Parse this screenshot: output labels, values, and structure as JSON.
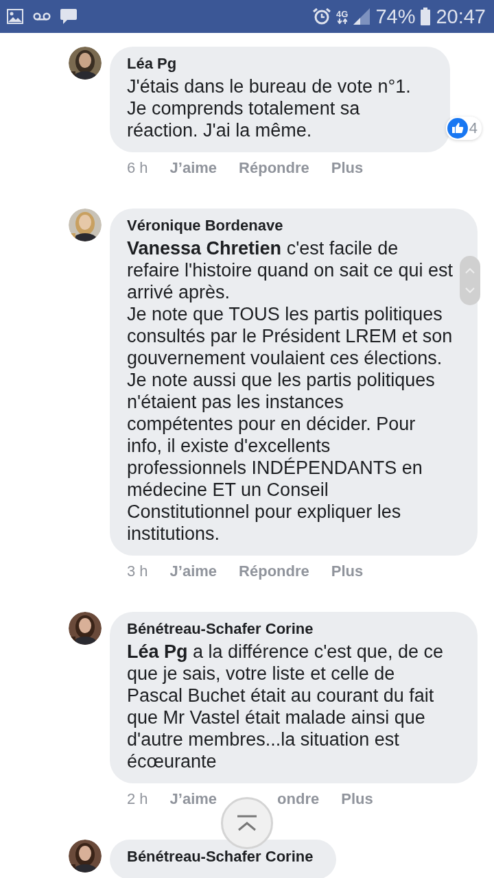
{
  "status_bar": {
    "network": "4G",
    "battery": "74%",
    "time": "20:47"
  },
  "comments": [
    {
      "author": "Léa Pg",
      "text": "J'étais dans le bureau de vote n°1.\nJe comprends totalement sa réaction. J'ai la même.",
      "reactions": {
        "count": "4"
      },
      "actions": [
        {
          "label": "6 h",
          "kind": "time"
        },
        {
          "label": "J’aime",
          "kind": "link"
        },
        {
          "label": "Répondre",
          "kind": "link"
        },
        {
          "label": "Plus",
          "kind": "link"
        }
      ]
    },
    {
      "author": "Véronique Bordenave",
      "text": "**Vanessa Chretien** c'est facile de refaire l'histoire quand on sait ce qui est arrivé après.\nJe note que TOUS les partis politiques consultés par le Président LREM et son gouvernement voulaient ces élections.\nJe note aussi que les partis politiques n'étaient pas les instances compétentes pour en décider. Pour info, il existe d'excellents professionnels INDÉPENDANTS en médecine ET un Conseil Constitutionnel pour expliquer les institutions.",
      "actions": [
        {
          "label": "3 h",
          "kind": "time"
        },
        {
          "label": "J’aime",
          "kind": "link"
        },
        {
          "label": "Répondre",
          "kind": "link"
        },
        {
          "label": "Plus",
          "kind": "link"
        }
      ]
    },
    {
      "author": "Bénétreau-Schafer Corine",
      "text": "**Léa Pg** a la différence c'est que, de ce que je sais, votre liste et celle de Pascal Buchet était au courant du fait que Mr Vastel était malade ainsi que d'autre membres...la situation est écœurante",
      "actions": [
        {
          "label": "2 h",
          "kind": "time"
        },
        {
          "label": "J’aime",
          "kind": "link"
        },
        {
          "label": "ondre",
          "kind": "covered"
        },
        {
          "label": "Plus",
          "kind": "link"
        }
      ]
    },
    {
      "author": "Bénétreau-Schafer Corine"
    }
  ]
}
